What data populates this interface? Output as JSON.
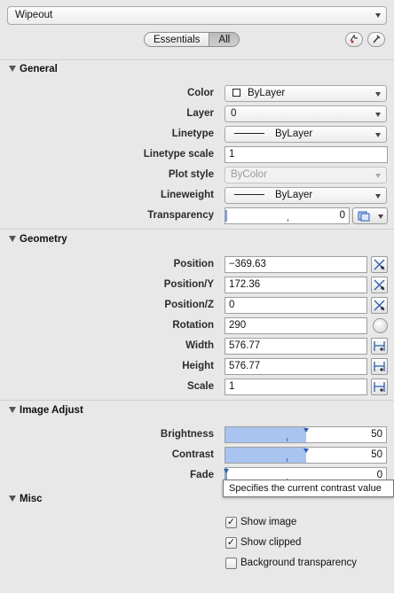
{
  "header": {
    "object_type": "Wipeout",
    "tabs": [
      {
        "label": "Essentials",
        "selected": false
      },
      {
        "label": "All",
        "selected": true
      }
    ]
  },
  "sections": {
    "general": {
      "title": "General",
      "rows": {
        "color": {
          "label": "Color",
          "value": "ByLayer"
        },
        "layer": {
          "label": "Layer",
          "value": "0"
        },
        "linetype": {
          "label": "Linetype",
          "value": "ByLayer"
        },
        "linetype_scale": {
          "label": "Linetype scale",
          "value": "1"
        },
        "plot_style": {
          "label": "Plot style",
          "value": "ByColor"
        },
        "lineweight": {
          "label": "Lineweight",
          "value": "ByLayer"
        },
        "transparency": {
          "label": "Transparency",
          "value": "0"
        }
      }
    },
    "geometry": {
      "title": "Geometry",
      "rows": {
        "position": {
          "label": "Position",
          "value": "−369.63"
        },
        "position_y": {
          "label": "Position/Y",
          "value": "172.36"
        },
        "position_z": {
          "label": "Position/Z",
          "value": "0"
        },
        "rotation": {
          "label": "Rotation",
          "value": "290"
        },
        "width": {
          "label": "Width",
          "value": "576.77"
        },
        "height": {
          "label": "Height",
          "value": "576.77"
        },
        "scale": {
          "label": "Scale",
          "value": "1"
        }
      }
    },
    "image_adjust": {
      "title": "Image Adjust",
      "rows": {
        "brightness": {
          "label": "Brightness",
          "value": "50",
          "level": 0.5
        },
        "contrast": {
          "label": "Contrast",
          "value": "50",
          "level": 0.5
        },
        "fade": {
          "label": "Fade",
          "value": "0",
          "level": 0
        }
      },
      "tooltip": "Specifies the current contrast value"
    },
    "misc": {
      "title": "Misc",
      "checks": [
        {
          "label": "Show image",
          "checked": true
        },
        {
          "label": "Show clipped",
          "checked": true
        },
        {
          "label": "Background transparency",
          "checked": false
        }
      ]
    }
  },
  "colors": {
    "slider_fill": "#a8c4ef",
    "accent": "#2f5fb3"
  }
}
